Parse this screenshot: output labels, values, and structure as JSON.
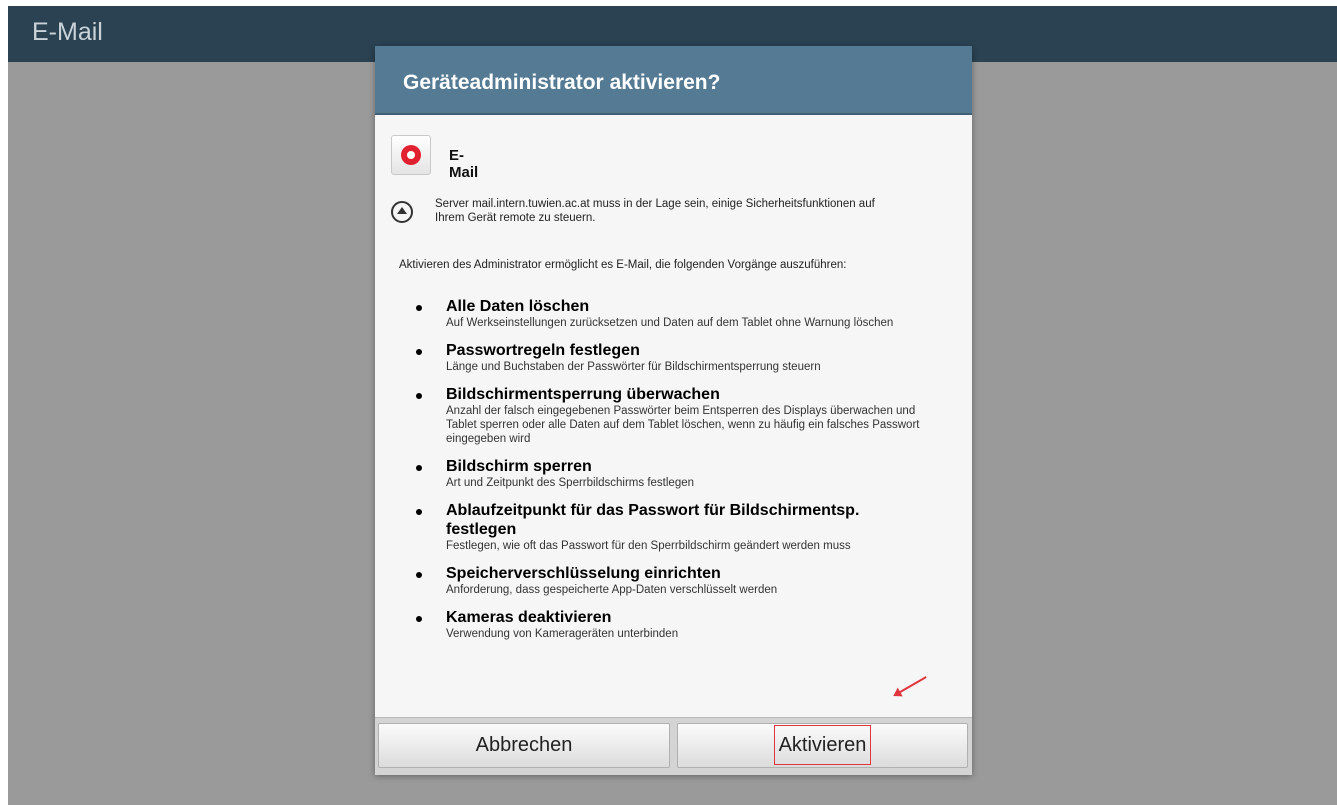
{
  "app_bar": {
    "title": "E-Mail"
  },
  "dialog": {
    "title": "Geräteadministrator aktivieren?",
    "app_name": "E-Mail",
    "server_text": "Server mail.intern.tuwien.ac.at muss in der Lage sein, einige Sicherheitsfunktionen auf Ihrem Gerät remote zu steuern.",
    "intro": "Aktivieren des Administrator ermöglicht es E-Mail, die folgenden Vorgänge auszuführen:",
    "permissions": [
      {
        "title": "Alle Daten löschen",
        "desc": "Auf Werkseinstellungen zurücksetzen und Daten auf dem Tablet ohne Warnung löschen"
      },
      {
        "title": "Passwortregeln festlegen",
        "desc": "Länge und Buchstaben der Passwörter für Bildschirmentsperrung steuern"
      },
      {
        "title": "Bildschirmentsperrung überwachen",
        "desc": "Anzahl der falsch eingegebenen Passwörter beim Entsperren des Displays überwachen und Tablet sperren oder alle Daten auf dem Tablet löschen, wenn zu häufig ein falsches Passwort eingegeben wird"
      },
      {
        "title": "Bildschirm sperren",
        "desc": "Art und Zeitpunkt des Sperrbildschirms festlegen"
      },
      {
        "title": "Ablaufzeitpunkt für das Passwort für Bildschirmentsp. festlegen",
        "desc": "Festlegen, wie oft das Passwort für den Sperrbildschirm geändert werden muss"
      },
      {
        "title": "Speicherverschlüsselung einrichten",
        "desc": "Anforderung, dass gespeicherte App-Daten verschlüsselt werden"
      },
      {
        "title": "Kameras deaktivieren",
        "desc": "Verwendung von Kamerageräten unterbinden"
      }
    ],
    "buttons": {
      "cancel": "Abbrechen",
      "activate": "Aktivieren"
    }
  },
  "colors": {
    "app_bar": "#2a4251",
    "dialog_header": "#557a94",
    "highlight": "#e0353d",
    "app_icon": "#e1212f"
  },
  "icons": [
    "mail-app-icon",
    "collapse-up-icon",
    "annotation-arrow"
  ]
}
